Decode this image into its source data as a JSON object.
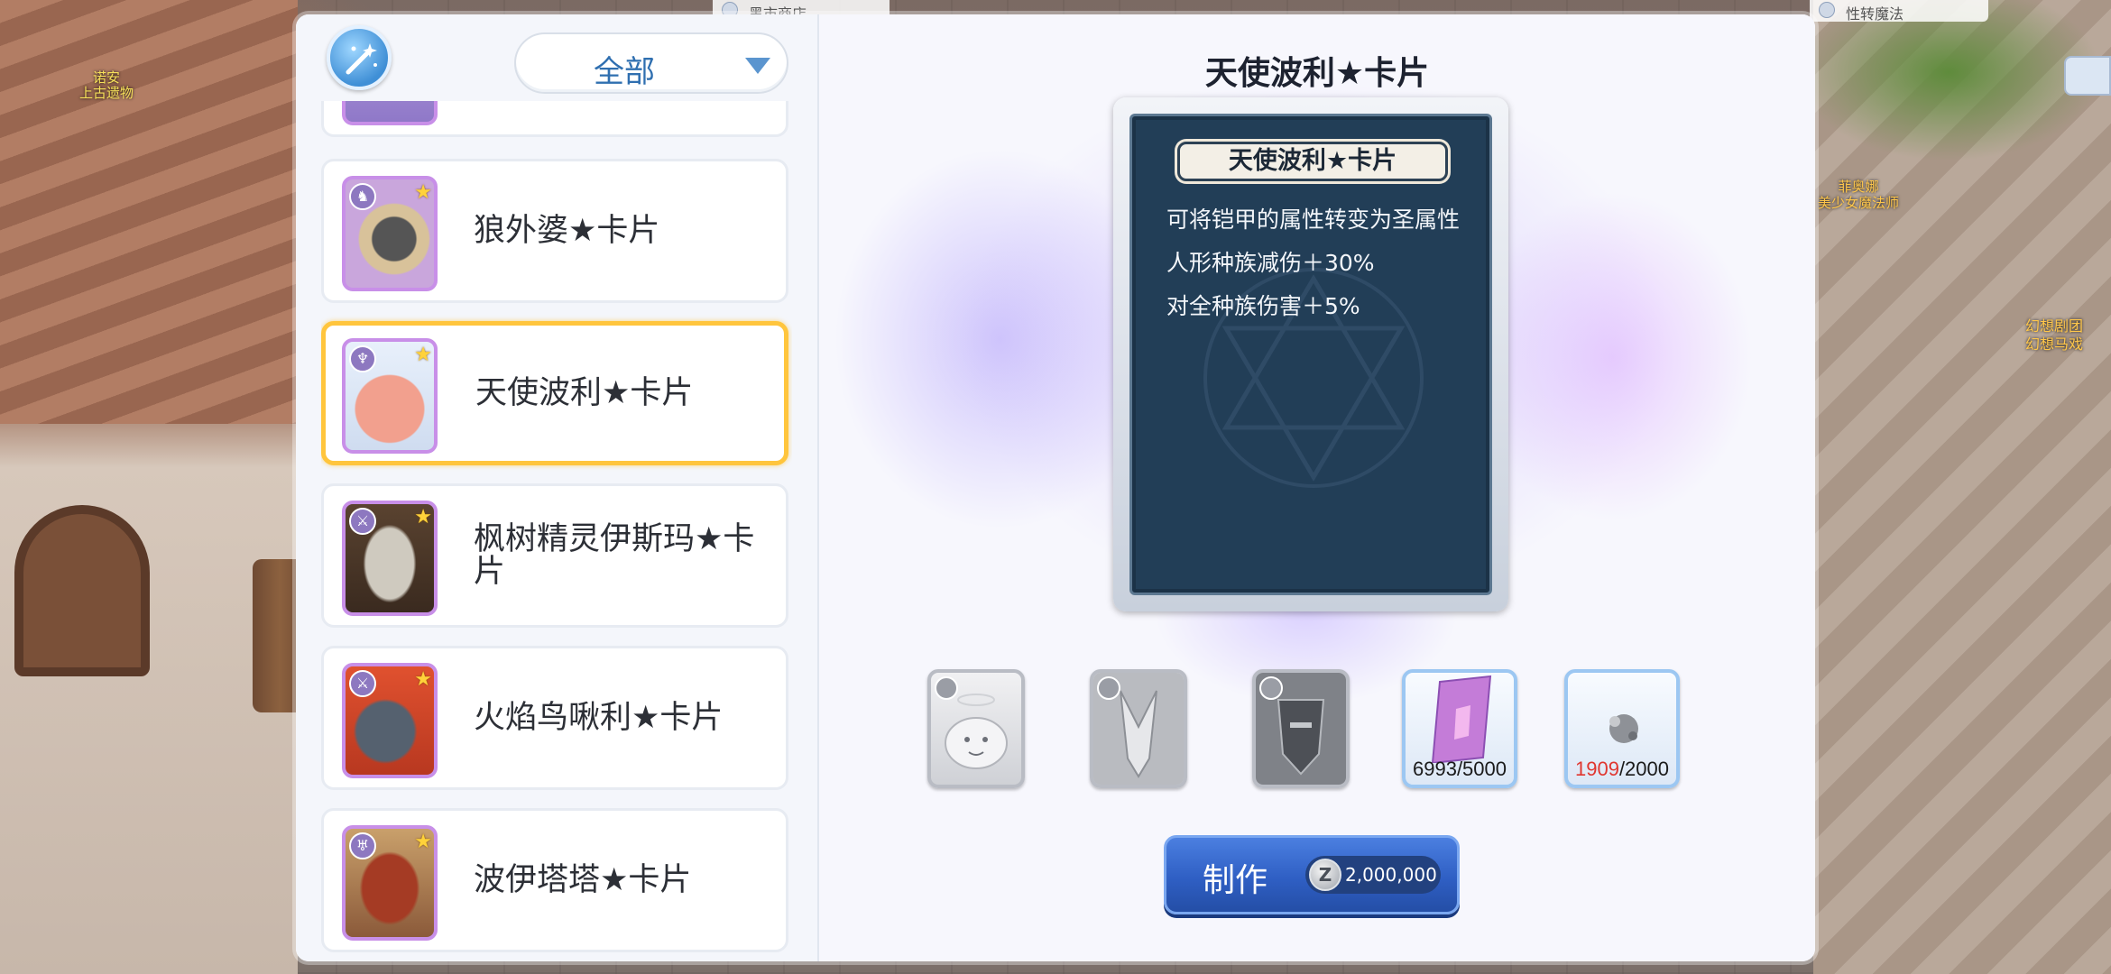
{
  "world": {
    "npc_left": "诺安\n上古遗物",
    "npc_right1": "菲奥娜\n美少女魔法师",
    "npc_right2": "幻想剧团\n幻想马戏",
    "top_tab_left": "黑市商店",
    "top_tab_right": "性转魔法"
  },
  "filter": {
    "label": "全部"
  },
  "cards": [
    {
      "name": "狼外婆★卡片",
      "race_icon": "demihuman-icon",
      "selected": false
    },
    {
      "name": "天使波利★卡片",
      "race_icon": "angel-icon",
      "selected": true
    },
    {
      "name": "枫树精灵伊斯玛★卡片",
      "race_icon": "sword-icon",
      "selected": false
    },
    {
      "name": "火焰鸟啾利★卡片",
      "race_icon": "sword-icon",
      "selected": false
    },
    {
      "name": "波伊塔塔★卡片",
      "race_icon": "demon-icon",
      "selected": false
    }
  ],
  "detail": {
    "title": "天使波利★卡片",
    "banner": "天使波利★卡片",
    "effects": [
      "可将铠甲的属性转变为圣属性",
      "人形种族减伤＋30%",
      "对全种族伤害＋5%"
    ]
  },
  "materials": [
    {
      "icon": "poring-card-icon",
      "count": ""
    },
    {
      "icon": "demon-card-icon",
      "count": ""
    },
    {
      "icon": "knight-card-icon",
      "count": ""
    },
    {
      "icon": "crystal-icon",
      "have": "6993",
      "need": "/5000"
    },
    {
      "icon": "dust-icon",
      "have": "1909",
      "need": "/2000",
      "insufficient": true
    }
  ],
  "make": {
    "label": "制作",
    "cost": "2,000,000",
    "currency_icon": "zeny-icon"
  },
  "colors": {
    "accent_blue": "#2f5fc4",
    "selected_border": "#ffc53d",
    "close_red": "#e1452f",
    "insufficient": "#e0362f"
  }
}
